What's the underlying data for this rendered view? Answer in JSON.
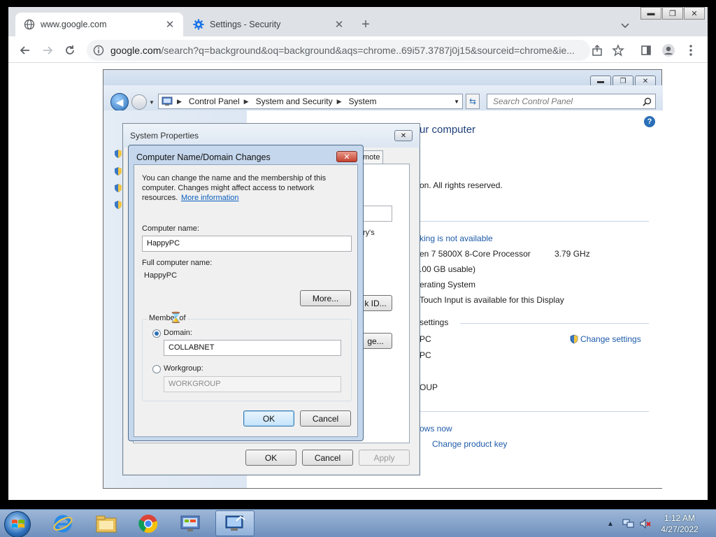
{
  "browser": {
    "tabs": [
      {
        "title": "www.google.com",
        "favicon": "globe-icon",
        "active": true
      },
      {
        "title": "Settings - Security",
        "favicon": "gear-icon",
        "active": false
      }
    ],
    "url_host": "google.com",
    "url_path": "/search?q=background&oq=background&aqs=chrome..69i57.3787j0j15&sourceid=chrome&ie...",
    "accent": "#1a73e8"
  },
  "control_panel": {
    "breadcrumbs": [
      "Control Panel",
      "System and Security",
      "System"
    ],
    "search_placeholder": "Search Control Panel",
    "heading_fragment": "ur computer",
    "copyright_fragment": "on.  All rights reserved.",
    "pen_fragment": "king is not available",
    "processor_fragment": "en 7 5800X 8-Core Processor",
    "processor_speed": "3.79 GHz",
    "ram_fragment": ".00 GB usable)",
    "os_fragment": "erating System",
    "touch_fragment": " Touch Input is available for this Display",
    "settings_fragment": " settings",
    "name_fragment_1": "PC",
    "name_fragment_2": "PC",
    "workgroup_fragment": "OUP",
    "change_settings": "Change settings",
    "windows_now_fragment": "ows now",
    "change_product_key": "Change product key"
  },
  "system_properties": {
    "title": "System Properties",
    "tab_fragment": "mote",
    "ordinal_fragment": "ry's",
    "netid_fragment": "k ID...",
    "change_fragment": "ge...",
    "ok": "OK",
    "cancel": "Cancel",
    "apply": "Apply"
  },
  "cnd_dialog": {
    "title": "Computer Name/Domain Changes",
    "description_line1": "You can change the name and the membership of this",
    "description_line2": "computer. Changes might affect access to network",
    "description_line3": "resources.",
    "more_info_link": "More information",
    "computer_name_label": "Computer name:",
    "computer_name_value": "HappyPC",
    "full_name_label": "Full computer name:",
    "full_name_value": "HappyPC",
    "more_button": "More...",
    "member_of_label": "Member of",
    "domain_label": "Domain:",
    "domain_value": "COLLABNET",
    "workgroup_label": "Workgroup:",
    "workgroup_value": "WORKGROUP",
    "selected": "domain",
    "ok": "OK",
    "cancel": "Cancel"
  },
  "taskbar": {
    "items": [
      "internet-explorer-icon",
      "file-explorer-icon",
      "chrome-icon",
      "control-panel-icon",
      "remote-desktop-icon"
    ],
    "time": "1:12 AM",
    "date": "4/27/2022"
  }
}
